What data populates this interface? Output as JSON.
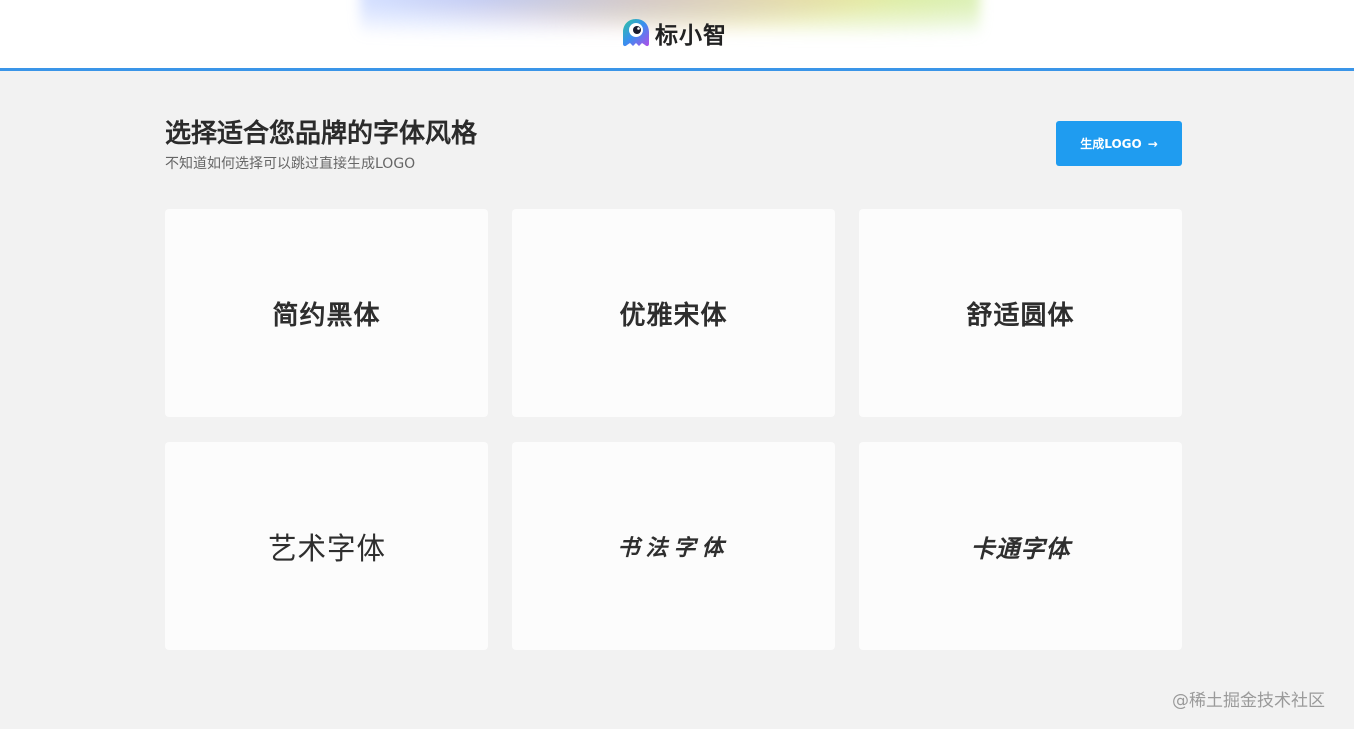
{
  "header": {
    "brand_name": "标小智",
    "accent_color": "#3a95e8"
  },
  "page": {
    "title": "选择适合您品牌的字体风格",
    "subtitle": "不知道如何选择可以跳过直接生成LOGO",
    "generate_button": "生成LOGO",
    "generate_button_icon": "arrow-right-icon",
    "button_color": "#1f9cf0"
  },
  "font_styles": [
    {
      "label": "简约黑体"
    },
    {
      "label": "优雅宋体"
    },
    {
      "label": "舒适圆体"
    },
    {
      "label": "艺术字体"
    },
    {
      "label": "书法字体"
    },
    {
      "label": "卡通字体"
    }
  ],
  "watermark": "@稀土掘金技术社区"
}
